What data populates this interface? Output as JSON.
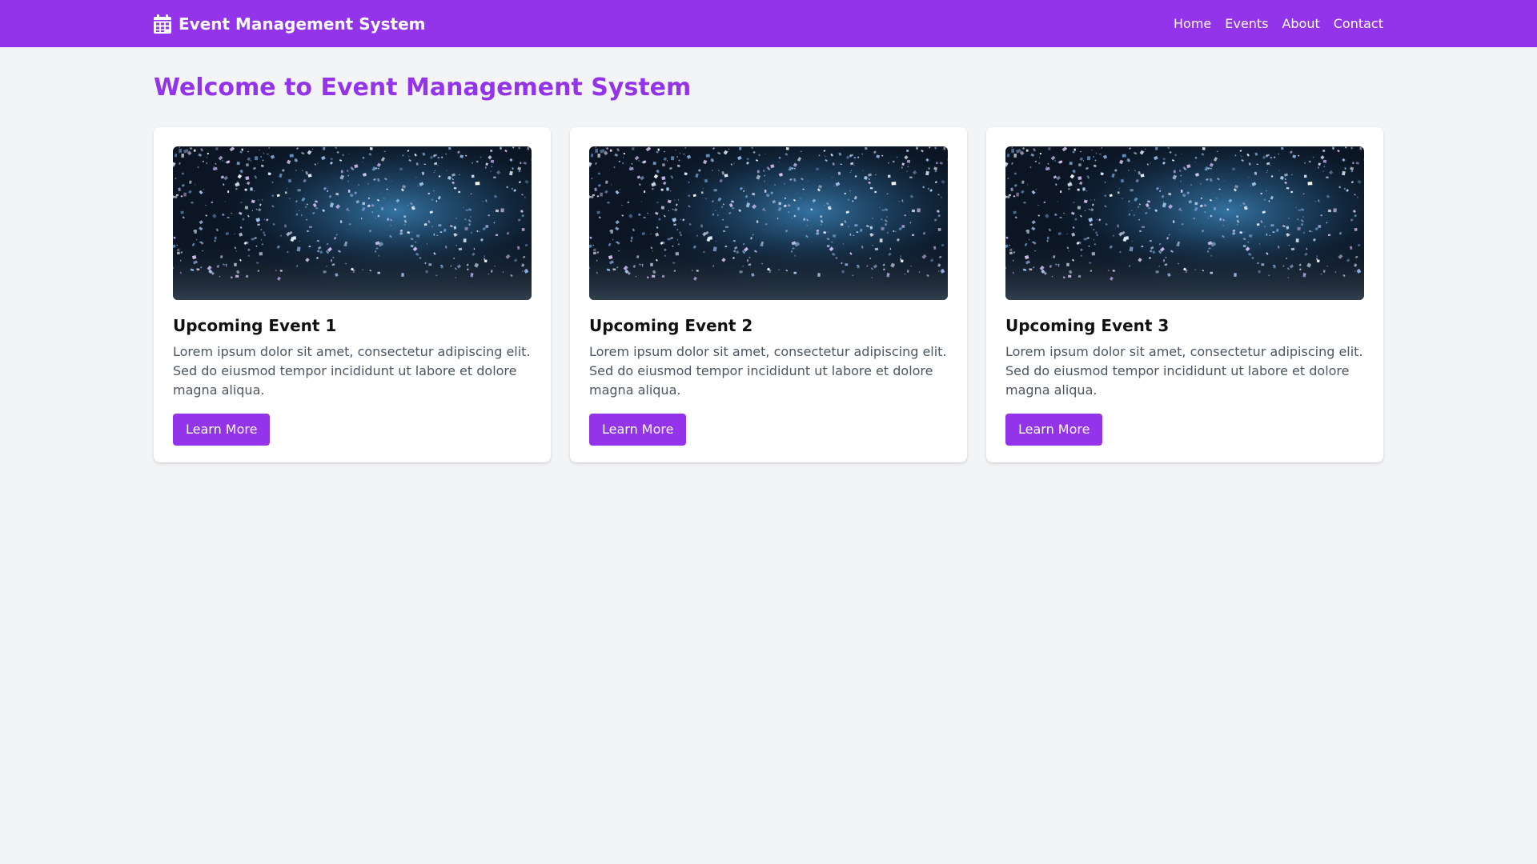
{
  "header": {
    "brand": "Event Management System",
    "brand_icon": "calendar-icon",
    "nav": [
      {
        "label": "Home"
      },
      {
        "label": "Events"
      },
      {
        "label": "About"
      },
      {
        "label": "Contact"
      }
    ]
  },
  "main": {
    "title": "Welcome to Event Management System",
    "cards": [
      {
        "title": "Upcoming Event 1",
        "text": "Lorem ipsum dolor sit amet, consectetur adipiscing elit. Sed do eiusmod tempor incididunt ut labore et dolore magna aliqua.",
        "button": "Learn More",
        "image": "confetti-photo"
      },
      {
        "title": "Upcoming Event 2",
        "text": "Lorem ipsum dolor sit amet, consectetur adipiscing elit. Sed do eiusmod tempor incididunt ut labore et dolore magna aliqua.",
        "button": "Learn More",
        "image": "confetti-photo"
      },
      {
        "title": "Upcoming Event 3",
        "text": "Lorem ipsum dolor sit amet, consectetur adipiscing elit. Sed do eiusmod tempor incididunt ut labore et dolore magna aliqua.",
        "button": "Learn More",
        "image": "confetti-photo"
      }
    ]
  },
  "colors": {
    "accent": "#9333ea",
    "background": "#f3f4f6",
    "card": "#ffffff",
    "body_text": "#4b5563"
  }
}
